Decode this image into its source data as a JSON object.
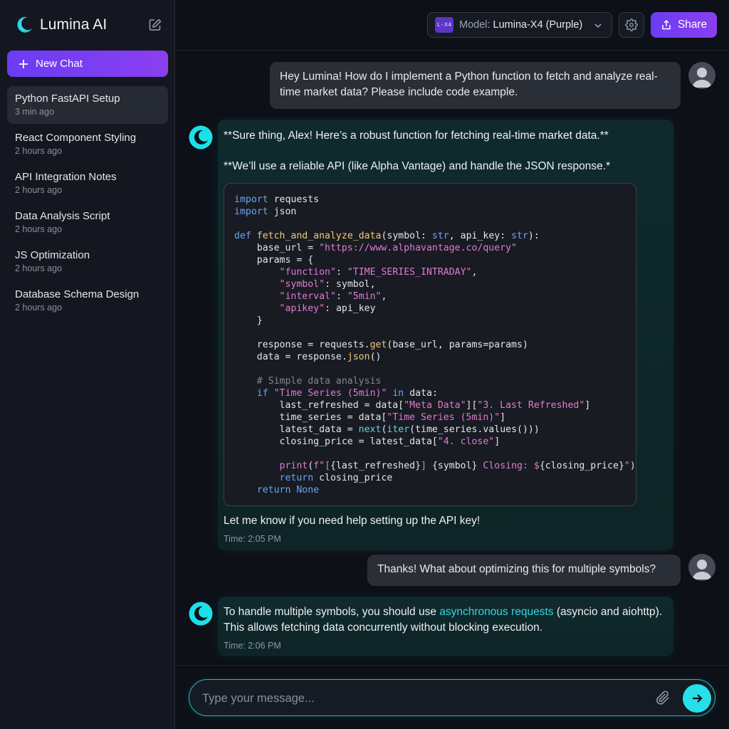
{
  "app": {
    "name": "Lumina AI"
  },
  "sidebar": {
    "new_chat_label": "New Chat",
    "chats": [
      {
        "title": "Python FastAPI Setup",
        "time": "3 min ago",
        "active": true
      },
      {
        "title": "React Component Styling",
        "time": "2 hours ago"
      },
      {
        "title": "API Integration Notes",
        "time": "2 hours ago"
      },
      {
        "title": "Data Analysis Script",
        "time": "2 hours ago"
      },
      {
        "title": "JS Optimization",
        "time": "2 hours ago"
      },
      {
        "title": "Database Schema Design",
        "time": "2 hours ago"
      }
    ]
  },
  "header": {
    "model_badge": "L-X4",
    "model_prefix": "Model:",
    "model_name": "Lumina-X4 (Purple)",
    "share_label": "Share"
  },
  "messages": {
    "user1": "Hey Lumina! How do I implement a Python function to fetch and analyze real-time market data? Please include code example.",
    "ai1": {
      "intro1": "**Sure thing, Alex! Here’s a robust function for fetching real-time market data.**",
      "intro2": "**We’ll use a reliable API (like Alpha Vantage) and handle the JSON response.*",
      "code": "import requests\nimport json\n\ndef fetch_and_analyze_data(symbol: str, api_key: str):\n    base_url = \"https://www.alphavantage.co/query\"\n    params = {\n        \"function\": \"TIME_SERIES_INTRADAY\",\n        \"symbol\": symbol,\n        \"interval\": \"5min\",\n        \"apikey\": api_key\n    }\n\n    response = requests.get(base_url, params=params)\n    data = response.json()\n\n    # Simple data analysis\n    if \"Time Series (5min)\" in data:\n        last_refreshed = data[\"Meta Data\"][\"3. Last Refreshed\"]\n        time_series = data[\"Time Series (5min)\"]\n        latest_data = next(iter(time_series.values()))\n        closing_price = latest_data[\"4. close\"]\n\n        print(f\"[{last_refreshed}] {symbol} Closing: ${closing_price}\")\n        return closing_price\n    return None",
      "outro": "Let me know if you need help setting up the API key!",
      "time": "Time: 2:05 PM"
    },
    "user2": "Thanks! What about optimizing this for multiple symbols?",
    "ai2": {
      "text_before": "To handle multiple symbols, you should use ",
      "highlight": "asynchronous requests",
      "text_after": " (asyncio and aiohttp). This allows fetching data concurrently without blocking execution.",
      "time": "Time: 2:06 PM"
    }
  },
  "composer": {
    "placeholder": "Type your message..."
  },
  "colors": {
    "accent_purple": "#7c3aed",
    "accent_cyan": "#27dfe8",
    "background": "#0d1017"
  }
}
